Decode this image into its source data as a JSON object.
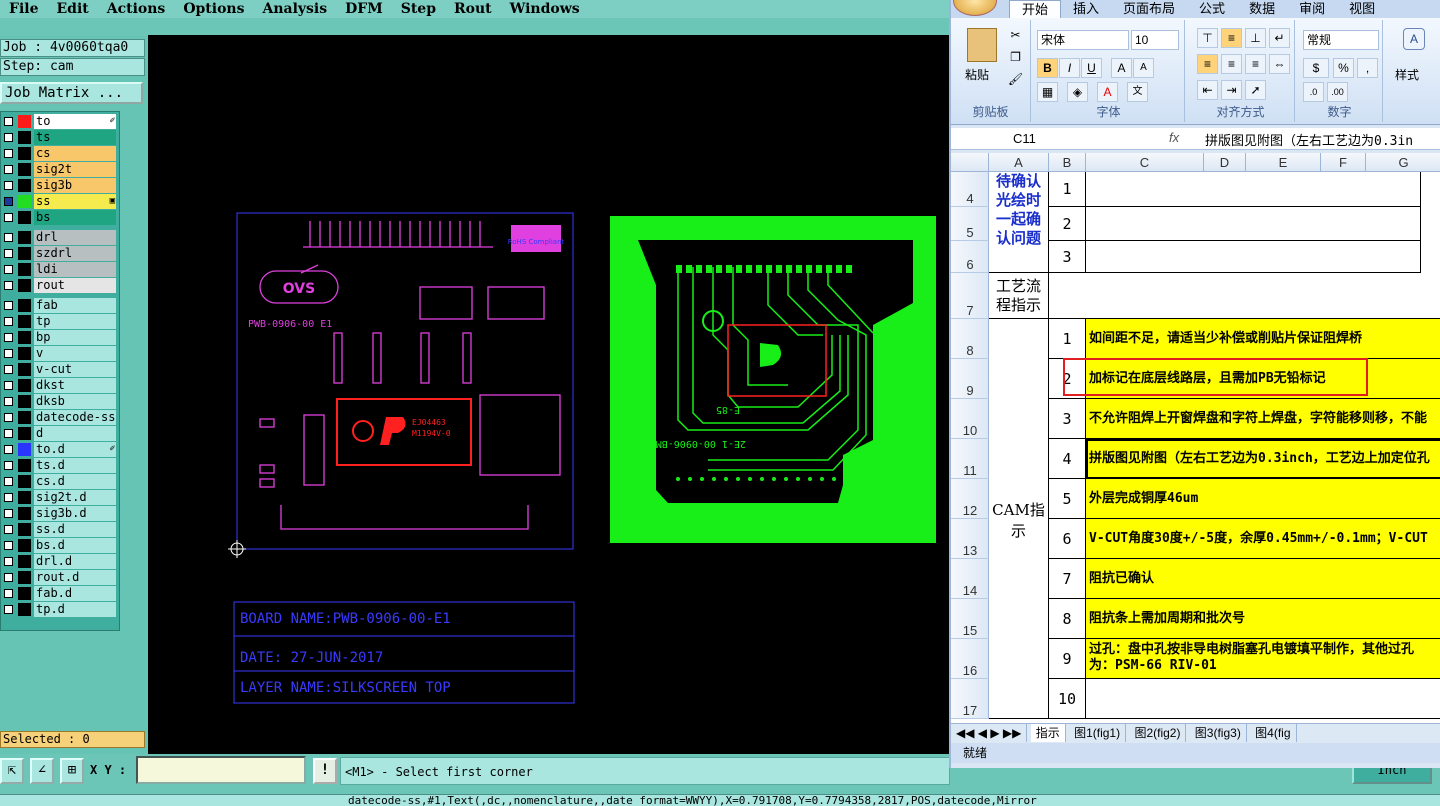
{
  "menu": [
    "File",
    "Edit",
    "Actions",
    "Options",
    "Analysis",
    "DFM",
    "Step",
    "Rout",
    "Windows"
  ],
  "left": {
    "job": "Job : 4v0060tqa0",
    "step": "Step: cam",
    "job_matrix": "Job Matrix ...",
    "selected": "Selected : 0"
  },
  "layers": [
    {
      "name": "to",
      "color": "#ff1a1a",
      "bg": "#ffffff",
      "box": "#ffffff",
      "mark": "✐"
    },
    {
      "name": "ts",
      "color": "#000000",
      "bg": "#1fa582",
      "box": "#ffffff",
      "mark": ""
    },
    {
      "name": "cs",
      "color": "#000000",
      "bg": "#f7c76a",
      "box": "#ffffff",
      "mark": ""
    },
    {
      "name": "sig2t",
      "color": "#000000",
      "bg": "#f7c76a",
      "box": "#ffffff",
      "mark": ""
    },
    {
      "name": "sig3b",
      "color": "#000000",
      "bg": "#f7c76a",
      "box": "#ffffff",
      "mark": ""
    },
    {
      "name": "ss",
      "color": "#22dd22",
      "bg": "#f5eb4f",
      "box": "#1b3a9e",
      "mark": "▣"
    },
    {
      "name": "bs",
      "color": "#000000",
      "bg": "#1fa582",
      "box": "#ffffff",
      "mark": ""
    },
    {
      "name": "drl",
      "color": "#000000",
      "bg": "#b7bfc0",
      "box": "#ffffff",
      "mark": ""
    },
    {
      "name": "szdrl",
      "color": "#000000",
      "bg": "#b7bfc0",
      "box": "#ffffff",
      "mark": ""
    },
    {
      "name": "ldi",
      "color": "#000000",
      "bg": "#b7bfc0",
      "box": "#ffffff",
      "mark": ""
    },
    {
      "name": "rout",
      "color": "#000000",
      "bg": "#e5e5e5",
      "box": "#ffffff",
      "mark": ""
    },
    {
      "name": "fab",
      "color": "#000000",
      "bg": "#a8e6df",
      "box": "#ffffff",
      "mark": ""
    },
    {
      "name": "tp",
      "color": "#000000",
      "bg": "#a8e6df",
      "box": "#ffffff",
      "mark": ""
    },
    {
      "name": "bp",
      "color": "#000000",
      "bg": "#a8e6df",
      "box": "#ffffff",
      "mark": ""
    },
    {
      "name": "v",
      "color": "#000000",
      "bg": "#a8e6df",
      "box": "#ffffff",
      "mark": ""
    },
    {
      "name": "v-cut",
      "color": "#000000",
      "bg": "#a8e6df",
      "box": "#ffffff",
      "mark": ""
    },
    {
      "name": "dkst",
      "color": "#000000",
      "bg": "#a8e6df",
      "box": "#ffffff",
      "mark": ""
    },
    {
      "name": "dksb",
      "color": "#000000",
      "bg": "#a8e6df",
      "box": "#ffffff",
      "mark": ""
    },
    {
      "name": "datecode-ss",
      "color": "#000000",
      "bg": "#a8e6df",
      "box": "#ffffff",
      "mark": ""
    },
    {
      "name": "d",
      "color": "#000000",
      "bg": "#a8e6df",
      "box": "#ffffff",
      "mark": ""
    },
    {
      "name": "to.d",
      "color": "#2a35ff",
      "bg": "#a8e6df",
      "box": "#ffffff",
      "mark": "✐"
    },
    {
      "name": "ts.d",
      "color": "#000000",
      "bg": "#a8e6df",
      "box": "#ffffff",
      "mark": ""
    },
    {
      "name": "cs.d",
      "color": "#000000",
      "bg": "#a8e6df",
      "box": "#ffffff",
      "mark": ""
    },
    {
      "name": "sig2t.d",
      "color": "#000000",
      "bg": "#a8e6df",
      "box": "#ffffff",
      "mark": ""
    },
    {
      "name": "sig3b.d",
      "color": "#000000",
      "bg": "#a8e6df",
      "box": "#ffffff",
      "mark": ""
    },
    {
      "name": "ss.d",
      "color": "#000000",
      "bg": "#a8e6df",
      "box": "#ffffff",
      "mark": ""
    },
    {
      "name": "bs.d",
      "color": "#000000",
      "bg": "#a8e6df",
      "box": "#ffffff",
      "mark": ""
    },
    {
      "name": "drl.d",
      "color": "#000000",
      "bg": "#a8e6df",
      "box": "#ffffff",
      "mark": ""
    },
    {
      "name": "rout.d",
      "color": "#000000",
      "bg": "#a8e6df",
      "box": "#ffffff",
      "mark": ""
    },
    {
      "name": "fab.d",
      "color": "#000000",
      "bg": "#a8e6df",
      "box": "#ffffff",
      "mark": ""
    },
    {
      "name": "tp.d",
      "color": "#000000",
      "bg": "#a8e6df",
      "box": "#ffffff",
      "mark": ""
    }
  ],
  "canvas": {
    "silk_pn": "PWB-0906-00 E1",
    "rohs": "RoHS Compliant",
    "logo": "OVS",
    "marking_line1": "EJ04463",
    "marking_line2": "M1194V-0",
    "title_block": [
      "BOARD NAME:PWB-0906-00-E1",
      "DATE: 27-JUN-2017",
      "LAYER NAME:SILKSCREEN TOP"
    ],
    "copper_text": "2E-1 00-0906-BMd",
    "copper_small": "E-85"
  },
  "bottom": {
    "xy_label": "X Y :",
    "xy_value": "",
    "prompt": "<M1> - Select first corner",
    "status": "datecode-ss,#1,Text(,dc,,nomenclature,,date_format=WWYY),X=0.791708,Y=0.7794358,2817,POS,datecode,Mirror",
    "units": "Inch"
  },
  "excel": {
    "tabs": [
      "开始",
      "插入",
      "页面布局",
      "公式",
      "数据",
      "审阅",
      "视图"
    ],
    "clipboard": {
      "paste": "粘贴",
      "label": "剪贴板"
    },
    "font": {
      "name": "宋体",
      "size": "10",
      "label": "字体"
    },
    "align": {
      "label": "对齐方式"
    },
    "number": {
      "format": "常规",
      "label": "数字",
      "percent": "%",
      "comma": ","
    },
    "styles": {
      "label": "样式"
    },
    "namebox": "C11",
    "fx": "fx",
    "formula": "拼版图见附图（左右工艺边为0.3in",
    "columns": [
      "A",
      "B",
      "C",
      "D",
      "E",
      "F",
      "G"
    ],
    "rows": [
      "4",
      "5",
      "6",
      "7",
      "8",
      "9",
      "10",
      "11",
      "12",
      "13",
      "14",
      "15",
      "16",
      "17"
    ],
    "confirm_label": "待确认光绘时一起确认问题",
    "process_label": "工艺流程指示",
    "cam_label": "CAM指示",
    "confirm_nums": [
      "1",
      "2",
      "3"
    ],
    "instructions": [
      {
        "n": "1",
        "text": "如间距不足，请适当少补偿或削贴片保证阻焊桥"
      },
      {
        "n": "2",
        "text": "加标记在底层线路层，且需加PB无铅标记"
      },
      {
        "n": "3",
        "text": "不允许阻焊上开窗焊盘和字符上焊盘，字符能移则移，不能"
      },
      {
        "n": "4",
        "text": "拼版图见附图（左右工艺边为0.3inch，工艺边上加定位孔"
      },
      {
        "n": "5",
        "text": "外层完成铜厚46um"
      },
      {
        "n": "6",
        "text": "V-CUT角度30度+/-5度，余厚0.45mm+/-0.1mm；V-CUT"
      },
      {
        "n": "7",
        "text": "阻抗已确认"
      },
      {
        "n": "8",
        "text": "阻抗条上需加周期和批次号"
      },
      {
        "n": "9",
        "text": "过孔：盘中孔按非导电树脂塞孔电镀填平制作，其他过孔",
        "text2": "为：PSM-66 RIV-01"
      },
      {
        "n": "10",
        "text": ""
      }
    ],
    "sheets": [
      "指示",
      "图1(fig1)",
      "图2(fig2)",
      "图3(fig3)",
      "图4(fig"
    ],
    "status": "就绪"
  }
}
